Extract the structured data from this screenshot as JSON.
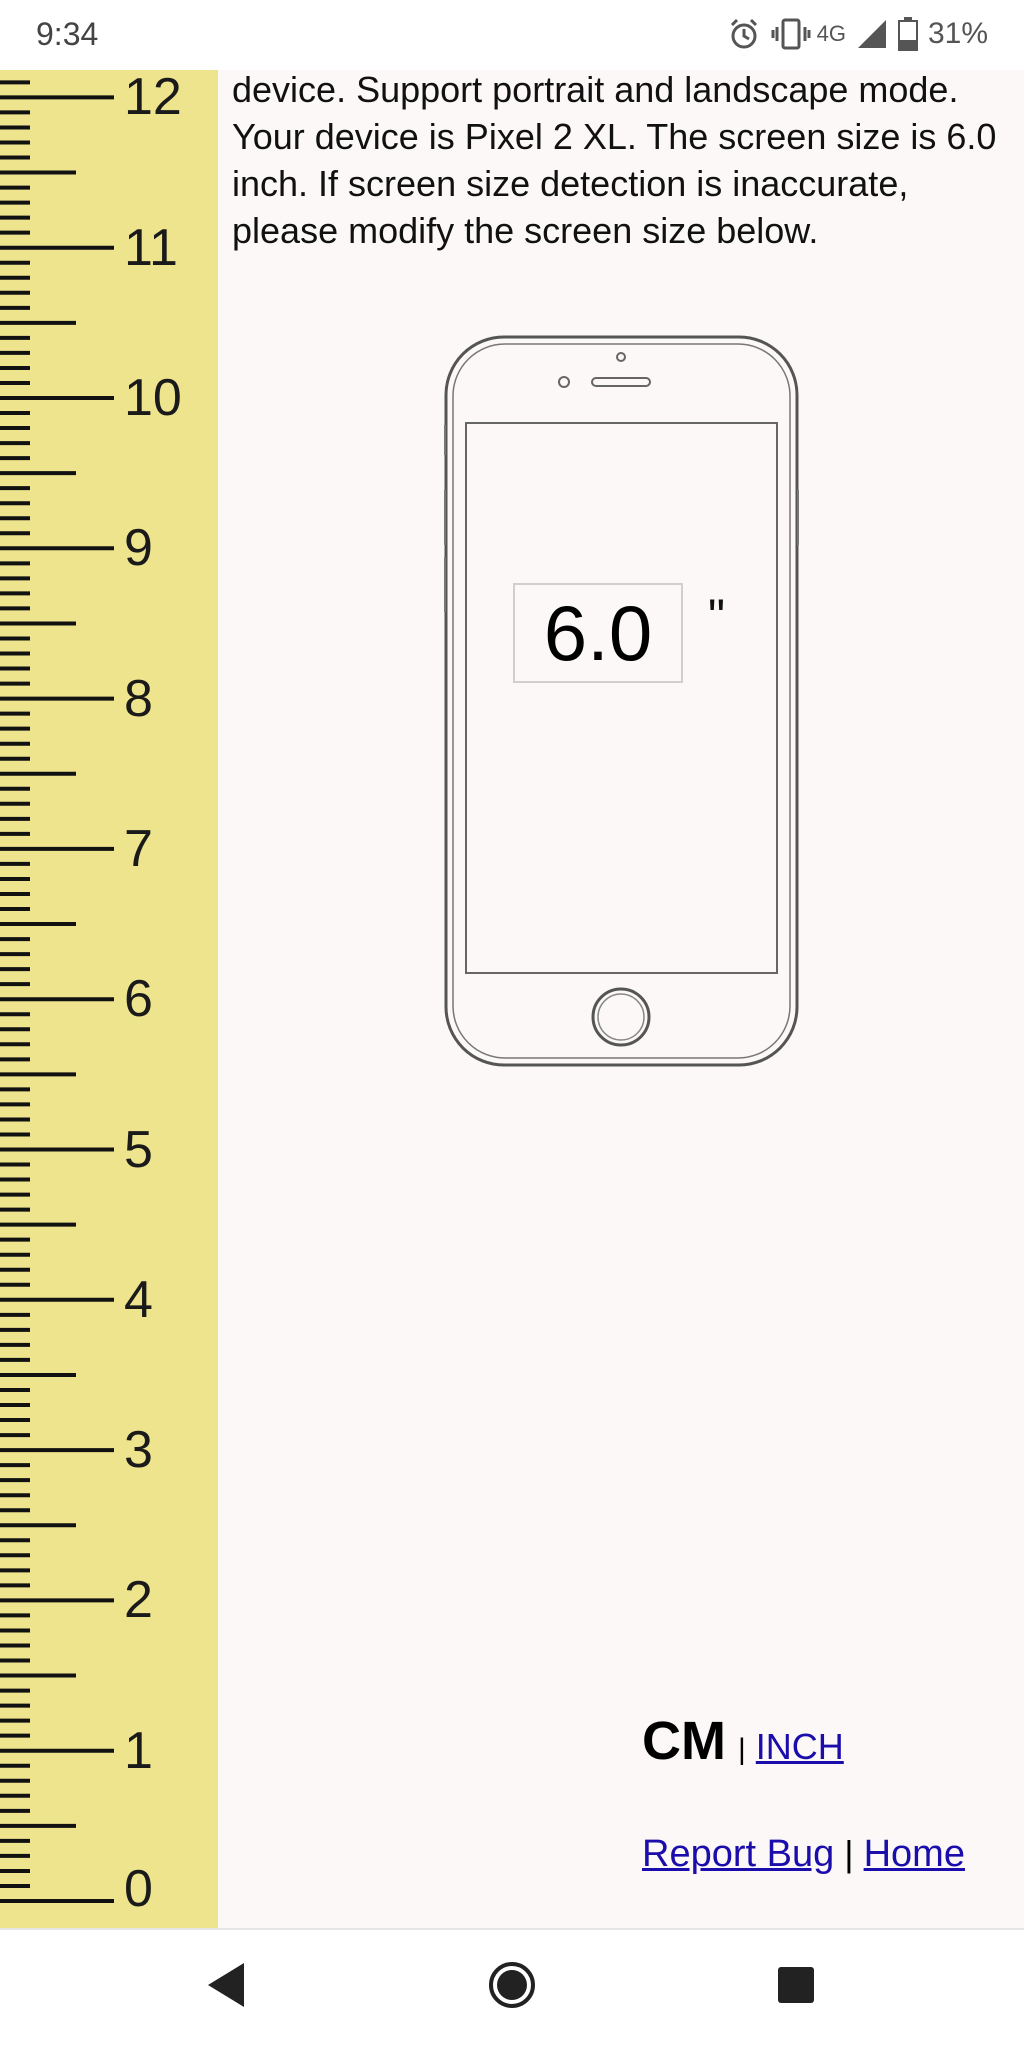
{
  "status_bar": {
    "time": "9:34",
    "network": "4G",
    "battery": "31%",
    "icons": [
      "alarm-icon",
      "vibrate-icon",
      "signal-icon",
      "battery-icon"
    ]
  },
  "ruler": {
    "background": "#eee48d",
    "labels": [
      "12",
      "11",
      "10",
      "9",
      "8",
      "7",
      "6",
      "5",
      "4",
      "3",
      "2",
      "1",
      "0"
    ]
  },
  "intro_text": "device. Support portrait and landscape mode. Your device is Pixel 2 XL. The screen size is 6.0 inch. If screen size detection is inaccurate, please modify the screen size below.",
  "screen_size": {
    "value": "6.0",
    "unit_mark": "\""
  },
  "units": {
    "cm_label": "CM",
    "separator": "|",
    "inch_label": "INCH"
  },
  "footer_links": {
    "report_bug": "Report Bug",
    "separator": "|",
    "home": "Home"
  },
  "nav": {
    "icons": [
      "back-icon",
      "home-icon",
      "recents-icon"
    ]
  }
}
